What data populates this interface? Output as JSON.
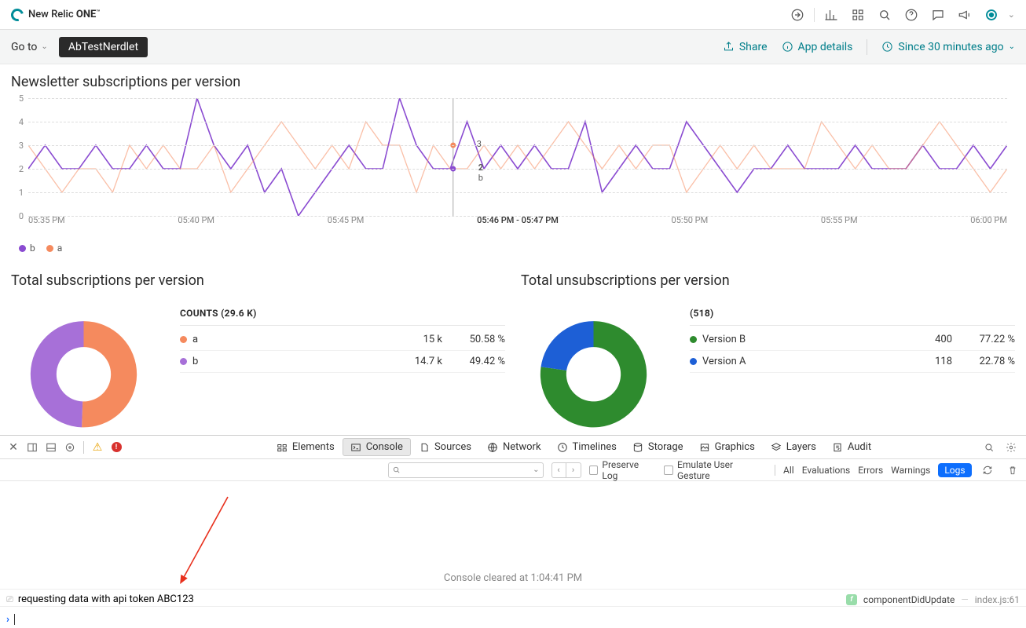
{
  "header": {
    "brand_prefix": "New Relic ",
    "brand_one": "ONE",
    "brand_tm": "™"
  },
  "subheader": {
    "goto": "Go to",
    "nerdlet": "AbTestNerdlet",
    "share": "Share",
    "app_details": "App details",
    "time_range": "Since 30 minutes ago"
  },
  "chart_data": {
    "line": {
      "type": "line",
      "title": "Newsletter subscriptions per version",
      "ylabel": "",
      "xlabel": "",
      "ylim": [
        0,
        5
      ],
      "yticks": [
        0,
        1,
        2,
        3,
        4,
        5
      ],
      "x_labels": [
        "05:35 PM",
        "05:40 PM",
        "05:45 PM",
        "05:46 PM - 05:47 PM",
        "05:50 PM",
        "05:55 PM",
        "06:00 PM"
      ],
      "hover": {
        "a": 3,
        "b": 2,
        "label": "b"
      },
      "legend": [
        "b",
        "a"
      ],
      "colors": {
        "b": "#8a4bd1",
        "a": "#f58a5e"
      },
      "series": [
        {
          "name": "b",
          "color": "#8a4bd1",
          "values": [
            2,
            3,
            2,
            2,
            3,
            2,
            2,
            3,
            2,
            2,
            5,
            3,
            2,
            3,
            1,
            2,
            0,
            1,
            2,
            3,
            2,
            2,
            5,
            3,
            2,
            2,
            4,
            2,
            3,
            2,
            3,
            2,
            2,
            4,
            1,
            2,
            3,
            2,
            2,
            4,
            3,
            2,
            1,
            2,
            2,
            3,
            2,
            2,
            2,
            3,
            2,
            2,
            2,
            3,
            2,
            2,
            3,
            2,
            3
          ]
        },
        {
          "name": "a",
          "color": "#f58a5e",
          "values": [
            3,
            2,
            1,
            2,
            2,
            1,
            3,
            2,
            3,
            2,
            2,
            3,
            1,
            2,
            3,
            4,
            3,
            2,
            3,
            2,
            4,
            3,
            3,
            1,
            3,
            2,
            2,
            3,
            2,
            3,
            2,
            3,
            4,
            3,
            2,
            3,
            2,
            3,
            3,
            1,
            2,
            3,
            2,
            3,
            2,
            2,
            2,
            4,
            3,
            2,
            3,
            2,
            2,
            3,
            4,
            3,
            2,
            1,
            2
          ]
        }
      ]
    },
    "subs": {
      "type": "pie",
      "title": "Total subscriptions per version",
      "counts_label": "COUNTS (29.6 K)",
      "rows": [
        {
          "label": "a",
          "value": "15 k",
          "pct": "50.58 %",
          "color": "#f58a5e",
          "frac": 0.5058
        },
        {
          "label": "b",
          "value": "14.7 k",
          "pct": "49.42 %",
          "color": "#a770d8",
          "frac": 0.4942
        }
      ]
    },
    "unsubs": {
      "type": "pie",
      "title": "Total unsubscriptions per version",
      "counts_label": "(518)",
      "rows": [
        {
          "label": "Version B",
          "value": "400",
          "pct": "77.22 %",
          "color": "#2e8b2e",
          "frac": 0.7722
        },
        {
          "label": "Version A",
          "value": "118",
          "pct": "22.78 %",
          "color": "#1d5fd6",
          "frac": 0.2278
        }
      ]
    }
  },
  "devtools": {
    "tabs": {
      "elements": "Elements",
      "console": "Console",
      "sources": "Sources",
      "network": "Network",
      "timelines": "Timelines",
      "storage": "Storage",
      "graphics": "Graphics",
      "layers": "Layers",
      "audit": "Audit"
    },
    "filters": {
      "preserve": "Preserve Log",
      "emulate": "Emulate User Gesture",
      "all": "All",
      "eval": "Evaluations",
      "errors": "Errors",
      "warnings": "Warnings",
      "logs": "Logs"
    },
    "cleared": "Console cleared at 1:04:41 PM",
    "log_msg": "requesting data with api token ABC123",
    "log_func": "componentDidUpdate",
    "log_src": "index.js:61"
  }
}
